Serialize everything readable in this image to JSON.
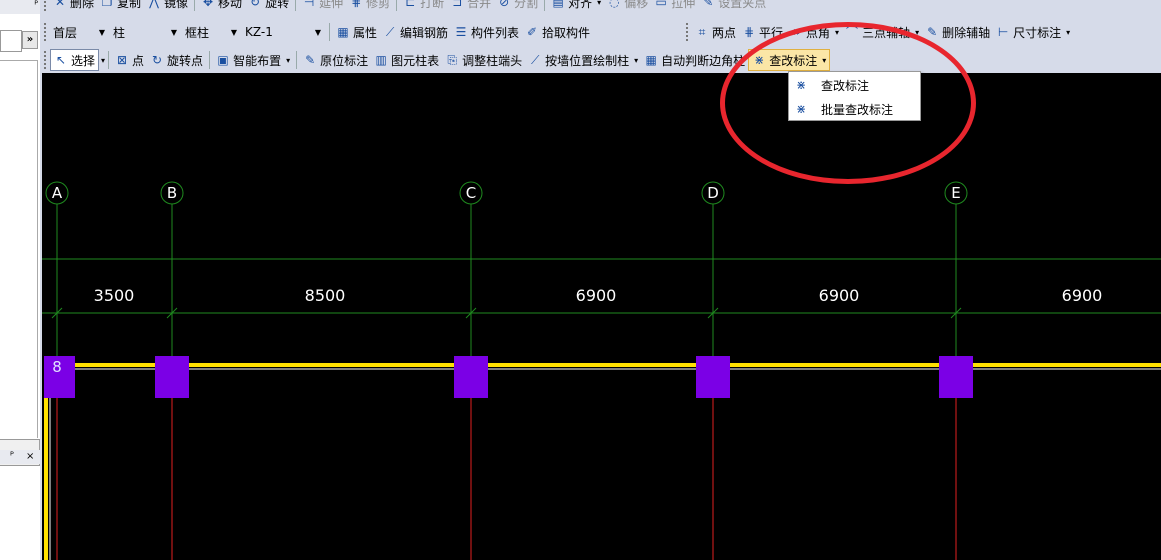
{
  "toolbar_top": {
    "items": [
      "删除",
      "复制",
      "镜像",
      "移动",
      "旋转",
      "延伸",
      "修剪",
      "打断",
      "合并",
      "分割",
      "对齐",
      "偏移",
      "拉伸",
      "设置夹点"
    ]
  },
  "toolbar_row1": {
    "floor": "首层",
    "category": "柱",
    "type": "框柱",
    "member": "KZ-1",
    "buttons": [
      "属性",
      "编辑钢筋",
      "构件列表",
      "拾取构件"
    ],
    "axis_tools": [
      "两点",
      "平行",
      "点角",
      "三点辅轴",
      "删除辅轴",
      "尺寸标注"
    ]
  },
  "toolbar_row2": {
    "select": "选择",
    "point": "点",
    "rotate_point": "旋转点",
    "smart_layout": "智能布置",
    "original_mark": "原位标注",
    "column_table": "图元柱表",
    "adjust_end": "调整柱端头",
    "draw_by_wall": "按墙位置绘制柱",
    "auto_corner": "自动判断边角柱",
    "check_mark": "查改标注"
  },
  "menu": {
    "items": [
      "查改标注",
      "批量查改标注"
    ]
  },
  "left_panel": {
    "expand": "»",
    "pin": "ᴾ",
    "close": "×"
  },
  "drawing": {
    "axes": [
      "A",
      "B",
      "C",
      "D",
      "E"
    ],
    "dimensions": [
      "3500",
      "8500",
      "6900",
      "6900",
      "6900"
    ],
    "row_label": "8"
  },
  "colors": {
    "canvas": "#000000",
    "axis_line": "#1f8a1f",
    "grid_line": "#e02020",
    "column": "#7b00e6",
    "wall": "#ffe000",
    "annotation": "#e8262e"
  }
}
